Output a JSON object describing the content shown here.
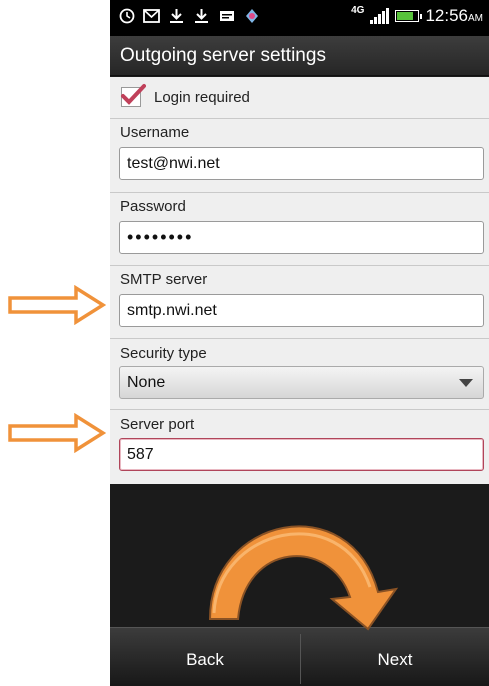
{
  "status_bar": {
    "network": "4G",
    "time": "12:56",
    "ampm": "AM",
    "icons": [
      "alarm-icon",
      "mail-icon",
      "download-icon",
      "download-icon",
      "message-icon",
      "app-icon"
    ]
  },
  "title": "Outgoing server settings",
  "form": {
    "login_required": {
      "label": "Login required",
      "checked": true
    },
    "username": {
      "label": "Username",
      "value": "test@nwi.net"
    },
    "password": {
      "label": "Password",
      "value": "••••••••"
    },
    "smtp_server": {
      "label": "SMTP server",
      "value": "smtp.nwi.net"
    },
    "security_type": {
      "label": "Security type",
      "value": "None"
    },
    "server_port": {
      "label": "Server port",
      "value": "587"
    }
  },
  "buttons": {
    "back": "Back",
    "next": "Next"
  },
  "colors": {
    "arrow_orange": "#f0923a",
    "focus_border": "#b0455a",
    "checkmark": "#c0405a"
  }
}
